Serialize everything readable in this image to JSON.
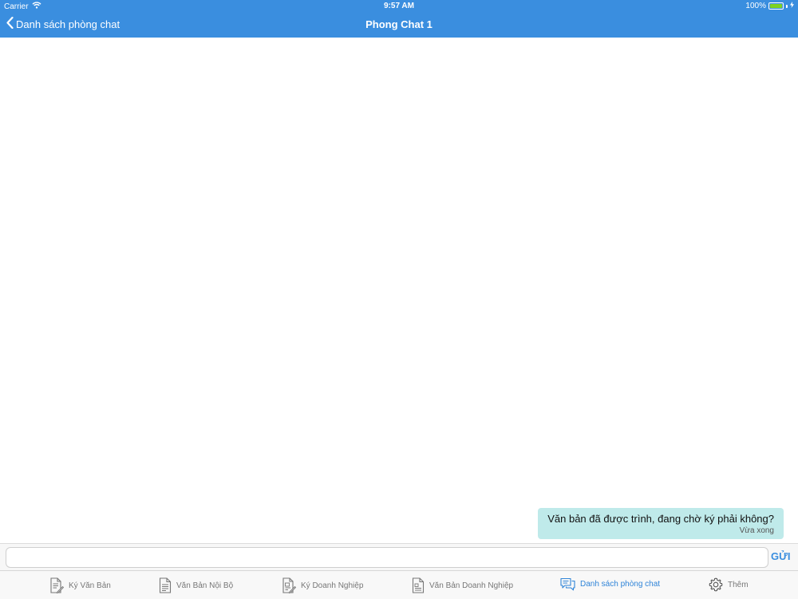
{
  "status_bar": {
    "carrier": "Carrier",
    "time": "9:57 AM",
    "battery": "100%"
  },
  "nav": {
    "back_label": "Danh sách phòng chat",
    "title": "Phong Chat 1"
  },
  "messages": [
    {
      "text": "Văn bản đã được trình, đang chờ ký phải không?",
      "time": "Vừa xong"
    }
  ],
  "composer": {
    "value": "",
    "placeholder": "",
    "send_label": "GỬI"
  },
  "tabs": [
    {
      "label": "Ký Văn Bản",
      "icon": "sign-document-icon"
    },
    {
      "label": "Văn Bản Nội Bộ",
      "icon": "document-icon"
    },
    {
      "label": "Ký Doanh Nghiệp",
      "icon": "sign-business-icon"
    },
    {
      "label": "Văn Bản Doanh Nghiệp",
      "icon": "business-document-icon"
    },
    {
      "label": "Danh sách phòng chat",
      "icon": "chat-bubbles-icon",
      "active": true
    },
    {
      "label": "Thêm",
      "icon": "gear-icon"
    }
  ],
  "colors": {
    "accent": "#3a8edf",
    "bubble": "#bfeaea",
    "battery": "#7ed321"
  }
}
